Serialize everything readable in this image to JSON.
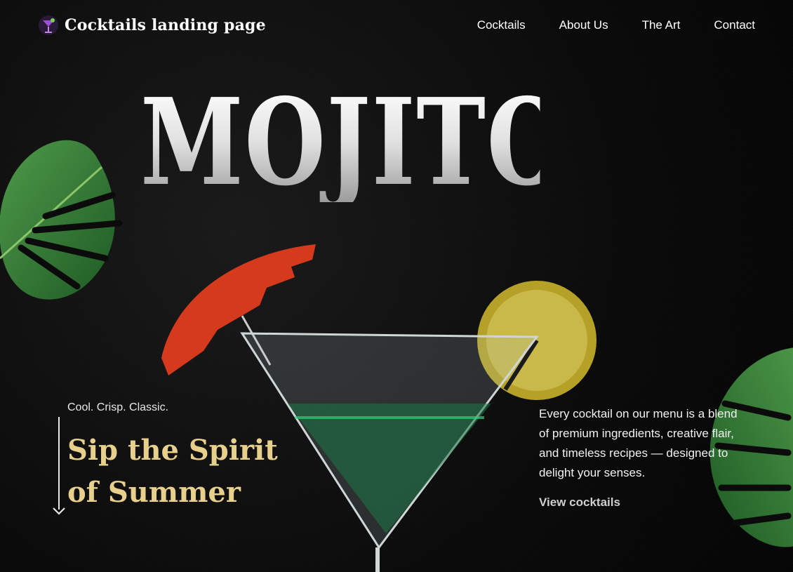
{
  "nav": {
    "brand": "Cocktails landing page",
    "brand_logo_icon": "cocktail-glass-icon",
    "links": [
      "Cocktails",
      "About Us",
      "The Art",
      "Contact"
    ]
  },
  "hero": {
    "title": "MOJITO",
    "tagline": "Cool. Crisp. Classic.",
    "subheading": "Sip the Spirit of Summer",
    "description": "Every cocktail on our menu is a blend of premium ingredients, creative flair, and timeless recipes — designed to delight your senses.",
    "cta": "View cocktails"
  },
  "colors": {
    "background": "#0b0b0b",
    "accent_gold": "#e7d08b",
    "text": "#ffffff"
  },
  "icons": {
    "arrow": "arrow-down-icon",
    "leaves": "monstera-leaf-icon",
    "glass": "martini-glass-icon"
  }
}
